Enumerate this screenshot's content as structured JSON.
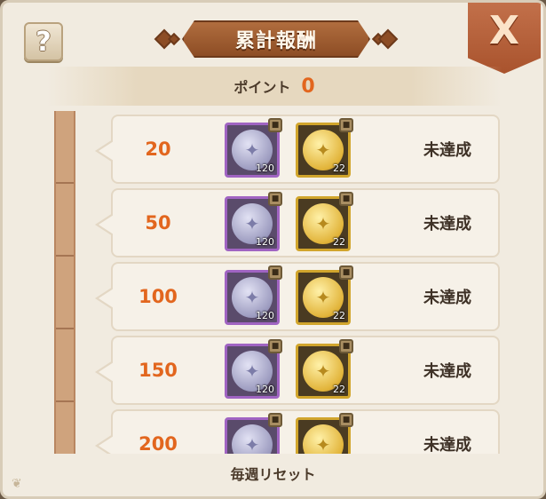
{
  "header": {
    "help_label": "?",
    "title": "累計報酬",
    "close_label": "X"
  },
  "points": {
    "label": "ポイント",
    "value": "0"
  },
  "rows": [
    {
      "threshold": "20",
      "silver_qty": "120",
      "gold_qty": "22",
      "status": "未達成"
    },
    {
      "threshold": "50",
      "silver_qty": "120",
      "gold_qty": "22",
      "status": "未達成"
    },
    {
      "threshold": "100",
      "silver_qty": "120",
      "gold_qty": "22",
      "status": "未達成"
    },
    {
      "threshold": "150",
      "silver_qty": "120",
      "gold_qty": "22",
      "status": "未達成"
    },
    {
      "threshold": "200",
      "silver_qty": "120",
      "gold_qty": "22",
      "status": "未達成"
    }
  ],
  "footer": {
    "reset_note": "毎週リセット"
  },
  "icons": {
    "silver_reward": "silver-coin-icon",
    "gold_reward": "gold-coin-icon",
    "lock": "lock-icon"
  },
  "colors": {
    "accent_orange": "#e2661e",
    "title_brown": "#8d4d25",
    "silver_frame": "#a064c2",
    "gold_frame": "#d1a52c"
  }
}
